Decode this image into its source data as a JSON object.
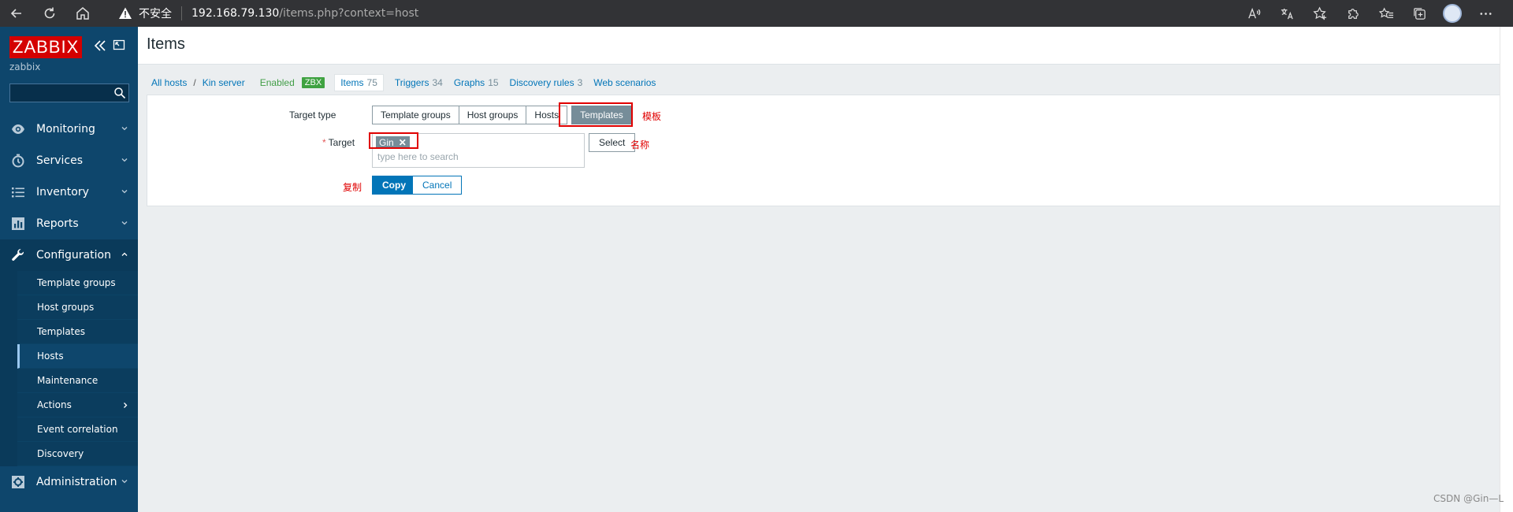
{
  "browser": {
    "insecure_label": "不安全",
    "url_host": "192.168.79.130",
    "url_path": "/items.php?context=host"
  },
  "sidebar": {
    "logo": "ZABBIX",
    "server_name": "zabbix",
    "search_value": "",
    "menu": [
      {
        "label": "Monitoring",
        "icon": "eye-icon"
      },
      {
        "label": "Services",
        "icon": "clock-icon"
      },
      {
        "label": "Inventory",
        "icon": "list-icon"
      },
      {
        "label": "Reports",
        "icon": "bar-chart-icon"
      },
      {
        "label": "Configuration",
        "icon": "wrench-icon"
      },
      {
        "label": "Administration",
        "icon": "gear-icon"
      }
    ],
    "submenu": [
      {
        "label": "Template groups"
      },
      {
        "label": "Host groups"
      },
      {
        "label": "Templates"
      },
      {
        "label": "Hosts"
      },
      {
        "label": "Maintenance"
      },
      {
        "label": "Actions"
      },
      {
        "label": "Event correlation"
      },
      {
        "label": "Discovery"
      }
    ]
  },
  "page": {
    "title": "Items"
  },
  "breadcrumbs": {
    "all_hosts": "All hosts",
    "sep": "/",
    "host": "Kin server",
    "enabled": "Enabled",
    "zbx": "ZBX",
    "tabs": [
      {
        "label": "Items",
        "count": "75"
      },
      {
        "label": "Triggers",
        "count": "34"
      },
      {
        "label": "Graphs",
        "count": "15"
      },
      {
        "label": "Discovery rules",
        "count": "3"
      },
      {
        "label": "Web scenarios",
        "count": ""
      }
    ]
  },
  "form": {
    "target_type_label": "Target type",
    "target_types": [
      "Template groups",
      "Host groups",
      "Hosts",
      "Templates"
    ],
    "selected_target_type": "Templates",
    "target_label": "Target",
    "required_mark": "*",
    "target_chip": "Gin",
    "chip_remove": "✕",
    "search_placeholder": "type here to search",
    "select_label": "Select",
    "copy_label": "Copy",
    "cancel_label": "Cancel"
  },
  "annotations": {
    "templates_note": "模板",
    "name_note": "名称",
    "copy_note": "复制",
    "color": "#e00000"
  },
  "watermark": "CSDN @Gin—L"
}
